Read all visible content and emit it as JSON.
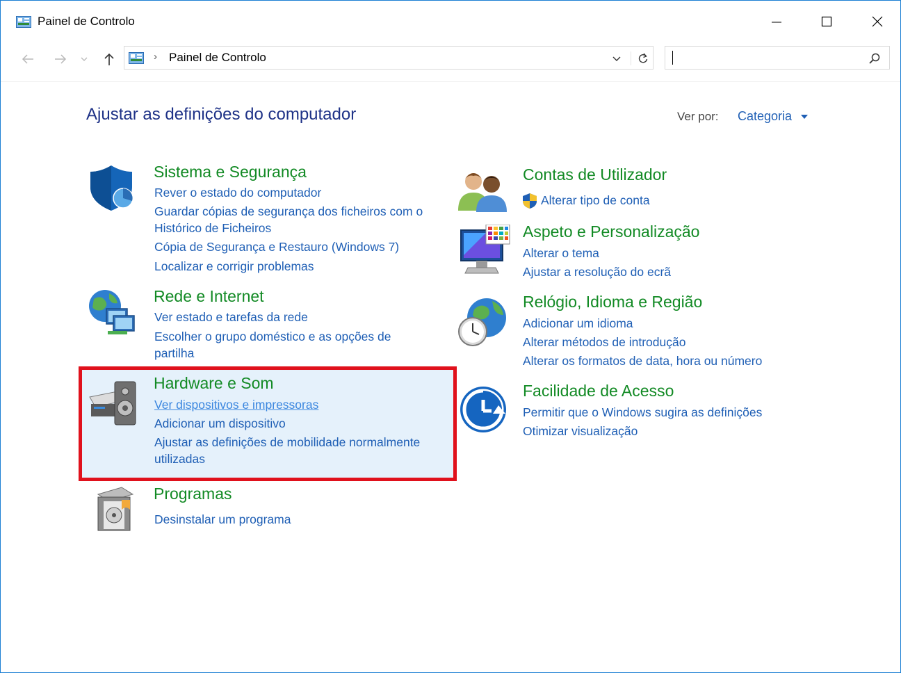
{
  "window": {
    "title": "Painel de Controlo",
    "controls": {
      "minimize": "minimize-icon",
      "maximize": "maximize-icon",
      "close": "close-icon"
    }
  },
  "address_bar": {
    "path": "Painel de Controlo",
    "separator": "›",
    "search_value": ""
  },
  "header": {
    "heading": "Ajustar as definições do computador",
    "view_by_label": "Ver por:",
    "view_by_value": "Categoria"
  },
  "categories": {
    "system": {
      "title": "Sistema e Segurança",
      "links": [
        "Rever o estado do computador",
        "Guardar cópias de segurança dos ficheiros com o",
        "Histórico de Ficheiros",
        "Cópia de Segurança e Restauro (Windows 7)",
        "Localizar e corrigir problemas"
      ]
    },
    "network": {
      "title": "Rede e Internet",
      "links": [
        "Ver estado e tarefas da rede",
        "Escolher o grupo doméstico e as opções de",
        "partilha"
      ]
    },
    "hardware": {
      "title": "Hardware e Som",
      "links": [
        "Ver dispositivos e impressoras",
        "Adicionar um dispositivo",
        "Ajustar as definições de mobilidade normalmente",
        "utilizadas"
      ]
    },
    "programs": {
      "title": "Programas",
      "links": [
        "Desinstalar um programa"
      ]
    },
    "accounts": {
      "title": "Contas de Utilizador",
      "links": [
        "Alterar tipo de conta"
      ]
    },
    "appearance": {
      "title": "Aspeto e Personalização",
      "links": [
        "Alterar o tema",
        "Ajustar a resolução do ecrã"
      ]
    },
    "clock": {
      "title": "Relógio, Idioma e Região",
      "links": [
        "Adicionar um idioma",
        "Alterar métodos de introdução",
        "Alterar os formatos de data, hora ou número"
      ]
    },
    "access": {
      "title": "Facilidade de Acesso",
      "links": [
        "Permitir que o Windows sugira as definições",
        "Otimizar visualização"
      ]
    }
  },
  "colors": {
    "category_title": "#128a24",
    "link": "#1f5fb5",
    "heading": "#1e3287",
    "highlight_border": "#e0111c",
    "highlight_fill": "#e5f1fb"
  }
}
